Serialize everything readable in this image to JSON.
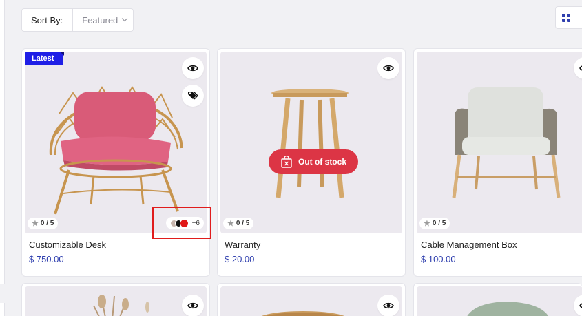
{
  "toolbar": {
    "sort_label": "Sort By:",
    "sort_value": "Featured",
    "view_mode": "grid"
  },
  "colors": {
    "accent": "#2f3fae",
    "latest_badge": "#1f1fe6",
    "out_of_stock": "#dc3545",
    "highlight": "#e01c1c"
  },
  "products": [
    {
      "name": "Customizable Desk",
      "price": "$ 750.00",
      "badge": "Latest",
      "rating": "0 / 5",
      "swatch_colors": [
        "#c8b6ae",
        "#111111",
        "#e01818"
      ],
      "swatch_more": "+6"
    },
    {
      "name": "Warranty",
      "price": "$ 20.00",
      "rating": "0 / 5",
      "stock_label": "Out of stock"
    },
    {
      "name": "Cable Management Box",
      "price": "$ 100.00",
      "rating": "0 / 5"
    }
  ]
}
